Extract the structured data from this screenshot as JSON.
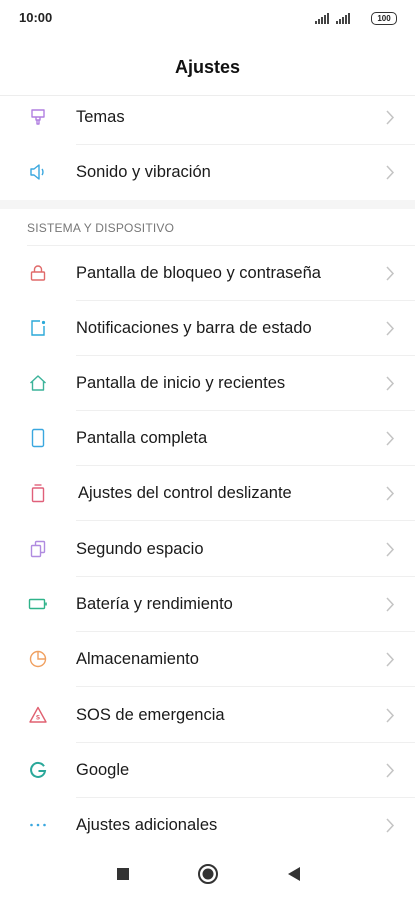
{
  "status_bar": {
    "time": "10:00",
    "battery": "100"
  },
  "header": {
    "title": "Ajustes"
  },
  "top_items": [
    {
      "label": "Temas",
      "icon": "theme-icon",
      "color": "#b07fe0"
    },
    {
      "label": "Sonido y vibración",
      "icon": "speaker-icon",
      "color": "#3aa7df"
    }
  ],
  "section": {
    "title": "SISTEMA Y DISPOSITIVO",
    "items": [
      {
        "label": "Pantalla de bloqueo y contraseña",
        "icon": "lock-icon",
        "color": "#e06a6a"
      },
      {
        "label": "Notificaciones y barra de estado",
        "icon": "notification-icon",
        "color": "#2aa9d8"
      },
      {
        "label": "Pantalla de inicio y recientes",
        "icon": "home-icon",
        "color": "#3cb39a"
      },
      {
        "label": "Pantalla completa",
        "icon": "phone-icon",
        "color": "#3aa7df"
      },
      {
        "label": "Ajustes del control deslizante",
        "icon": "slider-icon",
        "color": "#e0607a"
      },
      {
        "label": "Segundo espacio",
        "icon": "second-space-icon",
        "color": "#b08be0"
      },
      {
        "label": "Batería y rendimiento",
        "icon": "battery-icon",
        "color": "#2fb38a"
      },
      {
        "label": "Almacenamiento",
        "icon": "storage-icon",
        "color": "#f0a060"
      },
      {
        "label": "SOS de emergencia",
        "icon": "sos-icon",
        "color": "#e06070"
      },
      {
        "label": "Google",
        "icon": "google-icon",
        "color": "#2aa89a"
      },
      {
        "label": "Ajustes adicionales",
        "icon": "more-icon",
        "color": "#3aa7df"
      }
    ]
  },
  "navbar": {
    "recents": "square-icon",
    "home": "circle-icon",
    "back": "back-triangle-icon"
  }
}
